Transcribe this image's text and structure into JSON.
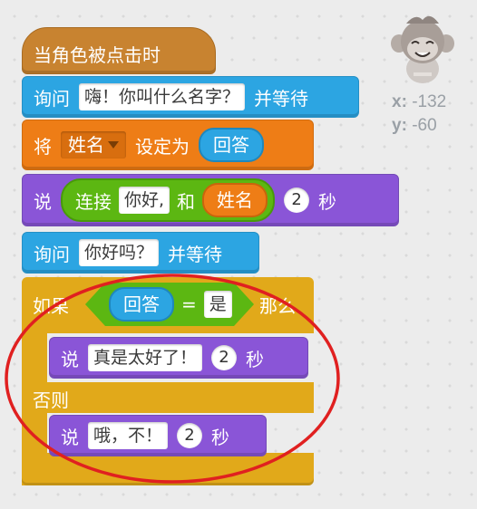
{
  "script": {
    "hat": "当角色被点击时",
    "ask1": {
      "label": "询问",
      "text": "嗨！你叫什么名字？",
      "suffix": "并等待"
    },
    "set": {
      "label": "将",
      "variable": "姓名",
      "suffix": "设定为",
      "value": "回答"
    },
    "say1": {
      "label": "说",
      "join_label": "连接",
      "first": "你好,",
      "and": "和",
      "second": "姓名",
      "secs": "2",
      "unit": "秒"
    },
    "ask2": {
      "label": "询问",
      "text": "你好吗？",
      "suffix": "并等待"
    },
    "if": {
      "label": "如果",
      "left": "回答",
      "op": "=",
      "right": "是",
      "then": "那么"
    },
    "say2": {
      "label": "说",
      "text": "真是太好了！",
      "secs": "2",
      "unit": "秒"
    },
    "else": "否则",
    "say3": {
      "label": "说",
      "text": "哦，不！",
      "secs": "2",
      "unit": "秒"
    }
  },
  "sprite": {
    "x_label": "x:",
    "x": "-132",
    "y_label": "y:",
    "y": "-60"
  },
  "colors": {
    "events": "#c88330",
    "sensing": "#2ca5e2",
    "data": "#ee7d16",
    "looks": "#8a55d7",
    "control": "#e1a91a",
    "operators": "#5cb712",
    "annotation": "#e02020"
  }
}
